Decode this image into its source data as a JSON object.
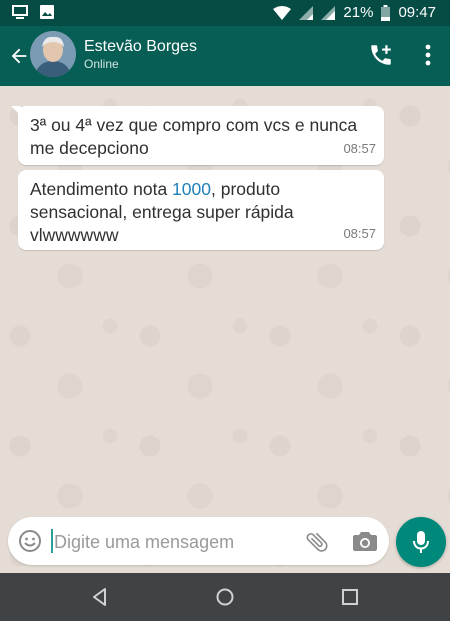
{
  "status_bar": {
    "battery_percent": "21%",
    "time": "09:47",
    "icons": [
      "screen-icon",
      "image-icon",
      "wifi-icon",
      "signal-icon",
      "signal-icon",
      "battery-icon"
    ]
  },
  "header": {
    "contact_name": "Estevão Borges",
    "contact_status": "Online",
    "icons": [
      "back-arrow-icon",
      "avatar",
      "call-add-icon",
      "more-vert-icon"
    ]
  },
  "messages": [
    {
      "text": "3ª ou 4ª vez que compro com vcs e nunca me decepciono",
      "time": "08:57"
    },
    {
      "text_before": "Atendimento nota ",
      "highlight": "1000",
      "text_after": ", produto sensacional, entrega super rápida vlwwwwww",
      "time": "08:57"
    }
  ],
  "composer": {
    "placeholder": "Digite uma mensagem",
    "value": "",
    "icons": [
      "emoji-icon",
      "attach-icon",
      "camera-icon",
      "mic-icon"
    ]
  },
  "colors": {
    "app_bar": "#075e54",
    "status_bar": "#054d44",
    "accent": "#00897b",
    "chat_background": "#e5ddd5",
    "link": "#1f7fb8"
  }
}
